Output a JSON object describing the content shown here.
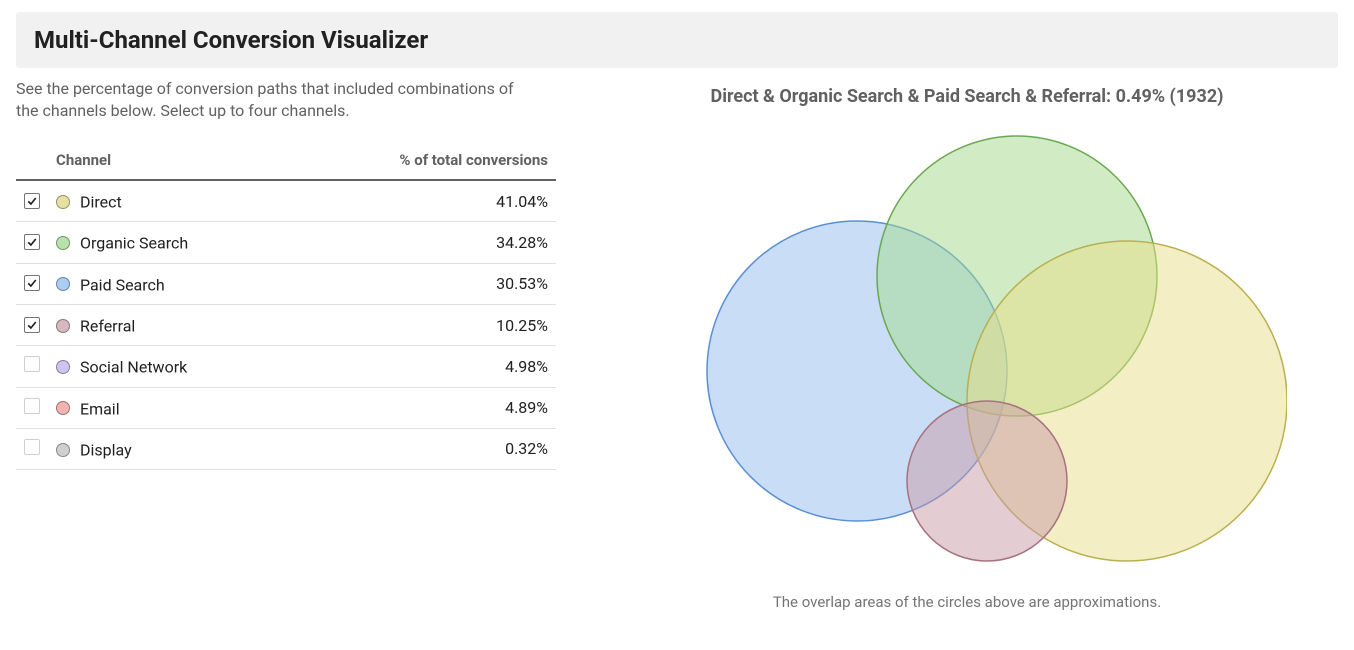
{
  "header": {
    "title": "Multi-Channel Conversion Visualizer"
  },
  "description": "See the percentage of conversion paths that included combinations of the channels below. Select up to four channels.",
  "table": {
    "columns": {
      "channel": "Channel",
      "pct": "% of total conversions"
    },
    "rows": [
      {
        "checked": true,
        "label": "Direct",
        "pct": "41.04%",
        "swatch": "#e6e0a3"
      },
      {
        "checked": true,
        "label": "Organic Search",
        "pct": "34.28%",
        "swatch": "#b7e2a8"
      },
      {
        "checked": true,
        "label": "Paid Search",
        "pct": "30.53%",
        "swatch": "#aacdf2"
      },
      {
        "checked": true,
        "label": "Referral",
        "pct": "10.25%",
        "swatch": "#d6b8c1"
      },
      {
        "checked": false,
        "label": "Social Network",
        "pct": "4.98%",
        "swatch": "#cfc3ef"
      },
      {
        "checked": false,
        "label": "Email",
        "pct": "4.89%",
        "swatch": "#f2b3b3"
      },
      {
        "checked": false,
        "label": "Display",
        "pct": "0.32%",
        "swatch": "#cfcfcf"
      }
    ]
  },
  "venn": {
    "title": "Direct & Organic Search & Paid Search & Referral: 0.49% (1932)",
    "caption": "The overlap areas of the circles above are approximations.",
    "colors": {
      "direct": {
        "fill": "#e7dd88",
        "stroke": "#b9af4f"
      },
      "organic": {
        "fill": "#a4d98c",
        "stroke": "#6aa84f"
      },
      "paid": {
        "fill": "#9cc3ef",
        "stroke": "#5a8fd6"
      },
      "referral": {
        "fill": "#c89aa6",
        "stroke": "#a8727f"
      }
    }
  },
  "chart_data": {
    "type": "table",
    "title": "Multi-Channel Conversion Visualizer",
    "columns": [
      "Channel",
      "% of total conversions"
    ],
    "rows": [
      [
        "Direct",
        41.04
      ],
      [
        "Organic Search",
        34.28
      ],
      [
        "Paid Search",
        30.53
      ],
      [
        "Referral",
        10.25
      ],
      [
        "Social Network",
        4.98
      ],
      [
        "Email",
        4.89
      ],
      [
        "Display",
        0.32
      ]
    ],
    "selected_overlap": {
      "channels": [
        "Direct",
        "Organic Search",
        "Paid Search",
        "Referral"
      ],
      "percent": 0.49,
      "count": 1932
    }
  }
}
